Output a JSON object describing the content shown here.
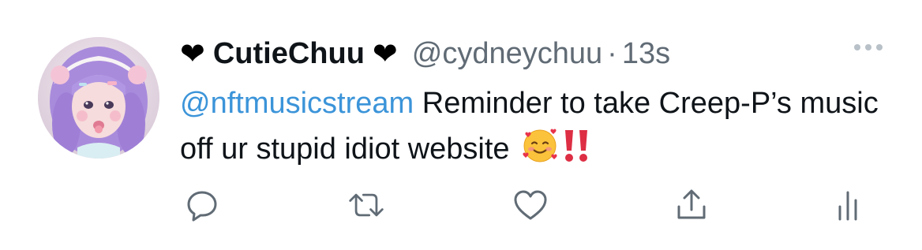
{
  "author": {
    "display_name": "CutieChuu",
    "name_prefix_icon": "heart-icon",
    "name_suffix_icon": "heart-icon",
    "prefix_glyph": "❤",
    "suffix_glyph": "❤",
    "handle": "@cydneychuu",
    "separator": "·",
    "timestamp": "13s",
    "avatar_icon": "profile-avatar"
  },
  "tweet": {
    "mention": "@nftmusicstream",
    "text": " Reminder to take Creep-P’s music off ur stupid idiot website",
    "emojis": [
      "smiling-face-with-hearts-emoji",
      "double-exclamation-emoji"
    ]
  },
  "actions": [
    {
      "name": "reply",
      "icon": "reply-icon"
    },
    {
      "name": "retweet",
      "icon": "retweet-icon"
    },
    {
      "name": "like",
      "icon": "heart-outline-icon"
    },
    {
      "name": "share",
      "icon": "share-icon"
    },
    {
      "name": "analytics",
      "icon": "analytics-icon"
    }
  ],
  "colors": {
    "mention": "#3b94d9",
    "secondary_text": "#606b75",
    "icon": "#606b75",
    "primary_text": "#0f1419"
  }
}
